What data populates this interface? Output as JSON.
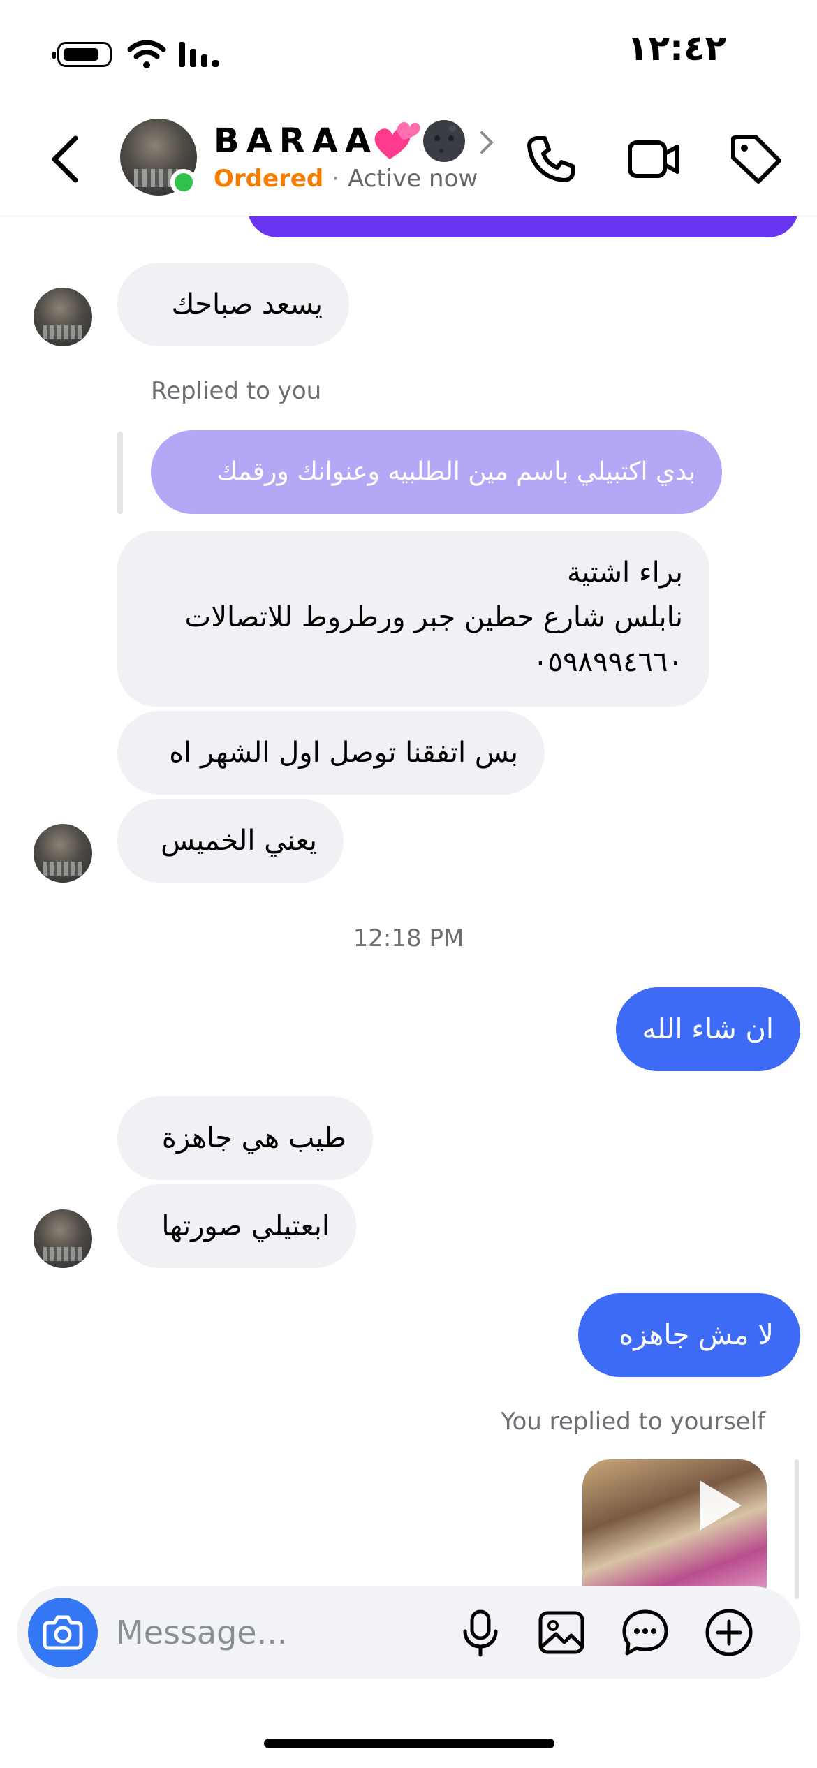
{
  "status_bar": {
    "time": "١٢:٤٢"
  },
  "header": {
    "contact_name": "BARAA",
    "contact_emoji": "💕🌚",
    "order_status": "Ordered",
    "separator": "·",
    "presence": "Active now",
    "accent_color": "#f57c00",
    "online_color": "#2fc24a"
  },
  "messages": {
    "m1": "يسعد صباحك",
    "reply_label": "Replied to you",
    "quoted": "بدي اكتبيلي باسم مين الطلبيه وعنوانك ورقمك",
    "address_line1": "براء اشتية",
    "address_line2": "نابلس شارع حطين جبر ورطروط للاتصالات",
    "address_line3": "٠٥٩٨٩٩٤٦٦٠",
    "m3": "بس اتفقنا توصل اول الشهر اه",
    "m4": "يعني الخميس",
    "timestamp": "12:18 PM",
    "out1": "ان شاء الله",
    "m5": "طيب هي جاهزة",
    "m6": "ابعتيلي صورتها",
    "out2": "لا مش جاهزه",
    "self_reply_label": "You replied to yourself"
  },
  "composer": {
    "placeholder": "Message..."
  },
  "colors": {
    "outgoing": "#3d6bf5",
    "incoming": "#f0f1f4",
    "quoted": "#b5a7f6",
    "camera": "#3578f6"
  },
  "icons": [
    "back-icon",
    "chevron-right-icon",
    "phone-icon",
    "video-icon",
    "tag-icon",
    "camera-icon",
    "microphone-icon",
    "gallery-icon",
    "sticker-icon",
    "plus-icon",
    "play-icon"
  ]
}
